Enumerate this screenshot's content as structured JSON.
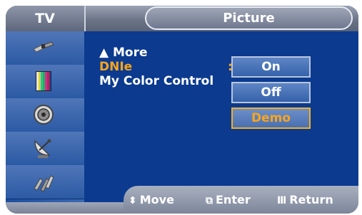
{
  "header": {
    "tv_label": "TV",
    "picture_label": "Picture"
  },
  "sidebar": {
    "icons": [
      "input-plug-icon",
      "color-bars-icon",
      "speaker-icon",
      "satellite-dish-icon",
      "connector-cables-icon"
    ]
  },
  "menu": {
    "items": [
      {
        "label": "▲ More"
      },
      {
        "label": "DNIe",
        "selected": true
      },
      {
        "label": "My Color Control"
      }
    ],
    "colon": ":"
  },
  "dropdown": {
    "options": [
      "On",
      "Off",
      "Demo"
    ],
    "selected": "Demo"
  },
  "footer": {
    "move": {
      "icon": "⬍",
      "label": "Move"
    },
    "enter": {
      "icon": "⧉",
      "label": "Enter"
    },
    "return": {
      "icon": "Ⅲ",
      "label": "Return"
    }
  },
  "colors": {
    "background": "#0b3a8f",
    "highlight": "#f7a51d",
    "text": "#ffffff"
  }
}
